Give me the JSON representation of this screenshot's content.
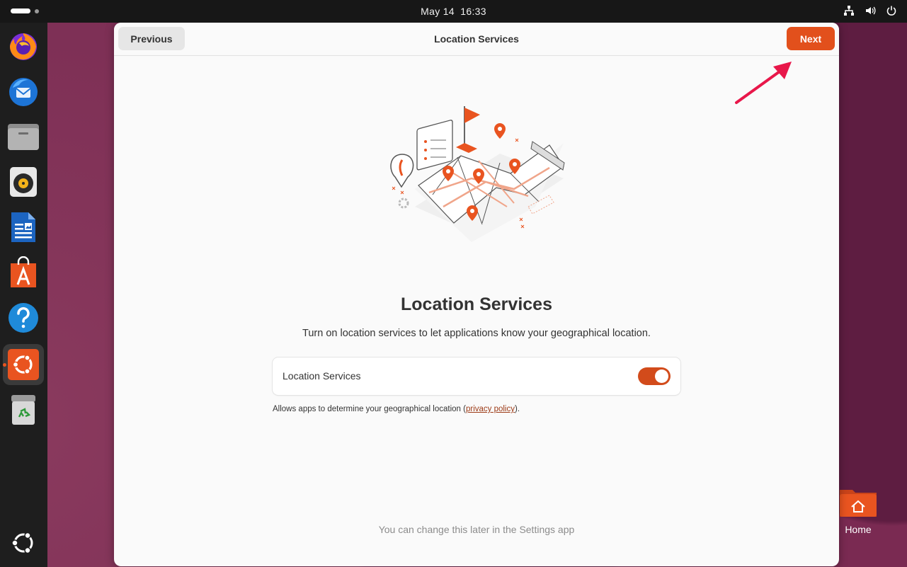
{
  "topbar": {
    "clock_date": "May 14",
    "clock_time": "16:33",
    "icons": [
      "network-icon",
      "volume-icon",
      "power-icon"
    ]
  },
  "dock": {
    "items": [
      {
        "name": "firefox",
        "icon": "firefox-icon"
      },
      {
        "name": "thunderbird",
        "icon": "thunderbird-icon"
      },
      {
        "name": "files",
        "icon": "files-icon"
      },
      {
        "name": "rhythmbox",
        "icon": "rhythmbox-icon"
      },
      {
        "name": "libreoffice-writer",
        "icon": "writer-icon"
      },
      {
        "name": "app-center",
        "icon": "app-center-icon"
      },
      {
        "name": "help",
        "icon": "help-icon"
      },
      {
        "name": "ubuntu-installer",
        "icon": "ubuntu-installer-icon",
        "active": true
      },
      {
        "name": "trash",
        "icon": "trash-icon"
      }
    ],
    "show_apps_icon": "ubuntu-show-apps-icon"
  },
  "desktop": {
    "home_label": "Home"
  },
  "window": {
    "header": {
      "previous_label": "Previous",
      "title": "Location Services",
      "next_label": "Next"
    },
    "main": {
      "title": "Location Services",
      "subtitle": "Turn on location services to let applications know your geographical location.",
      "toggle_row": {
        "label": "Location Services",
        "enabled": true
      },
      "note_prefix": "Allows apps to determine your geographical location (",
      "note_link": "privacy policy",
      "note_suffix": ").",
      "footer_hint": "You can change this later in the Settings app"
    }
  },
  "colors": {
    "accent": "#e2501c",
    "toggle_on": "#d24b1b",
    "window_bg": "#fafafa",
    "annotation_arrow": "#e8174a"
  }
}
